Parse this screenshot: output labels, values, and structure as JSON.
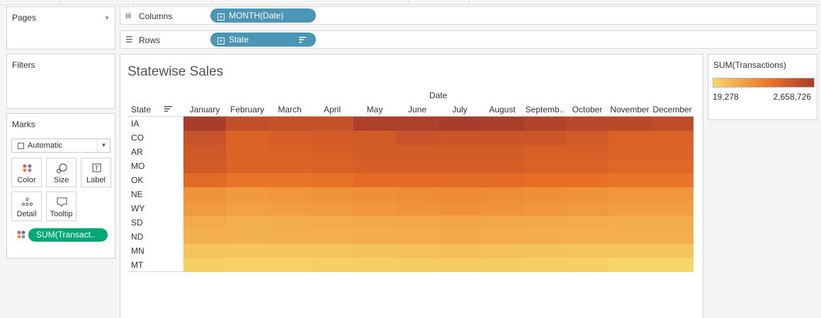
{
  "sidebar": {
    "pages": {
      "title": "Pages"
    },
    "filters": {
      "title": "Filters"
    },
    "marks": {
      "title": "Marks",
      "mark_type": "Automatic",
      "buttons": [
        {
          "label": "Color",
          "icon": "color-icon"
        },
        {
          "label": "Size",
          "icon": "size-icon"
        },
        {
          "label": "Label",
          "icon": "label-icon"
        },
        {
          "label": "Detail",
          "icon": "detail-icon"
        },
        {
          "label": "Tooltip",
          "icon": "tooltip-icon"
        }
      ],
      "color_field": "SUM(Transact.."
    }
  },
  "shelves": {
    "columns": {
      "label": "Columns",
      "pill": "MONTH(Date)"
    },
    "rows": {
      "label": "Rows",
      "pill": "State"
    }
  },
  "viz": {
    "title": "Statewise Sales",
    "column_header": "Date",
    "row_header": "State",
    "columns": [
      "January",
      "February",
      "March",
      "April",
      "May",
      "June",
      "July",
      "August",
      "Septemb..",
      "October",
      "November",
      "December"
    ],
    "rows": [
      "IA",
      "CO",
      "AR",
      "MO",
      "OK",
      "NE",
      "WY",
      "SD",
      "ND",
      "MN",
      "MT"
    ]
  },
  "legend": {
    "title": "SUM(Transactions)",
    "min_label": "19,278",
    "max_label": "2,658,726",
    "colors": [
      "#f6d66b",
      "#f1963e",
      "#e86d25",
      "#a83d2b"
    ]
  },
  "chart_data": {
    "type": "heatmap",
    "title": "Statewise Sales",
    "xlabel": "Date",
    "ylabel": "State",
    "x": [
      "January",
      "February",
      "March",
      "April",
      "May",
      "June",
      "July",
      "August",
      "Septemb..",
      "October",
      "November",
      "December"
    ],
    "y": [
      "IA",
      "CO",
      "AR",
      "MO",
      "OK",
      "NE",
      "WY",
      "SD",
      "ND",
      "MN",
      "MT"
    ],
    "value_label": "SUM(Transactions)",
    "color_range": [
      19278,
      2658726
    ],
    "values": [
      [
        2650000,
        2250000,
        2200000,
        2200000,
        2600000,
        2600000,
        2658726,
        2640000,
        2520000,
        2400000,
        2380000,
        2300000
      ],
      [
        2150000,
        1850000,
        1900000,
        1950000,
        2000000,
        2150000,
        2100000,
        2100000,
        2100000,
        2000000,
        1850000,
        1850000
      ],
      [
        2050000,
        1800000,
        1850000,
        1900000,
        1950000,
        1950000,
        1950000,
        1950000,
        1900000,
        1900000,
        1800000,
        1800000
      ],
      [
        2000000,
        1800000,
        1800000,
        1850000,
        1900000,
        1900000,
        1900000,
        1900000,
        1850000,
        1850000,
        1750000,
        1750000
      ],
      [
        1700000,
        1500000,
        1500000,
        1550000,
        1650000,
        1650000,
        1700000,
        1700000,
        1600000,
        1600000,
        1500000,
        1500000
      ],
      [
        1000000,
        900000,
        950000,
        1000000,
        1050000,
        1100000,
        1150000,
        1100000,
        1050000,
        1000000,
        950000,
        950000
      ],
      [
        900000,
        800000,
        850000,
        900000,
        950000,
        1000000,
        1050000,
        1000000,
        950000,
        900000,
        850000,
        850000
      ],
      [
        650000,
        600000,
        620000,
        650000,
        680000,
        700000,
        720000,
        700000,
        680000,
        650000,
        620000,
        620000
      ],
      [
        600000,
        560000,
        580000,
        600000,
        620000,
        640000,
        660000,
        640000,
        620000,
        600000,
        580000,
        580000
      ],
      [
        300000,
        260000,
        280000,
        300000,
        320000,
        340000,
        360000,
        340000,
        320000,
        300000,
        280000,
        280000
      ],
      [
        120000,
        80000,
        90000,
        100000,
        120000,
        150000,
        160000,
        150000,
        120000,
        100000,
        19278,
        40000
      ]
    ]
  }
}
